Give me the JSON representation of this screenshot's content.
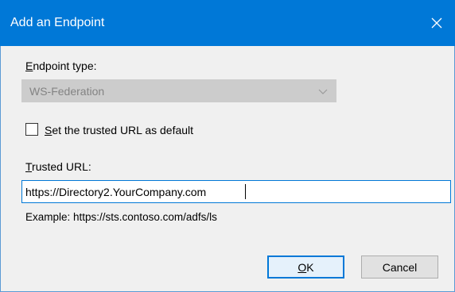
{
  "window": {
    "title": "Add an Endpoint",
    "close_icon": "close-icon",
    "accent_color": "#0078d7"
  },
  "endpoint_type": {
    "label_mnemonic": "E",
    "label_rest": "ndpoint type:",
    "selected": "WS-Federation",
    "enabled": false
  },
  "default_checkbox": {
    "checked": false,
    "label_mnemonic": "S",
    "label_rest": "et the trusted URL as default"
  },
  "trusted_url": {
    "label_mnemonic": "T",
    "label_rest": "rusted URL:",
    "value": "https://Directory2.YourCompany.com",
    "example": "Example: https://sts.contoso.com/adfs/ls"
  },
  "buttons": {
    "ok_mnemonic": "O",
    "ok_rest": "K",
    "cancel": "Cancel"
  }
}
